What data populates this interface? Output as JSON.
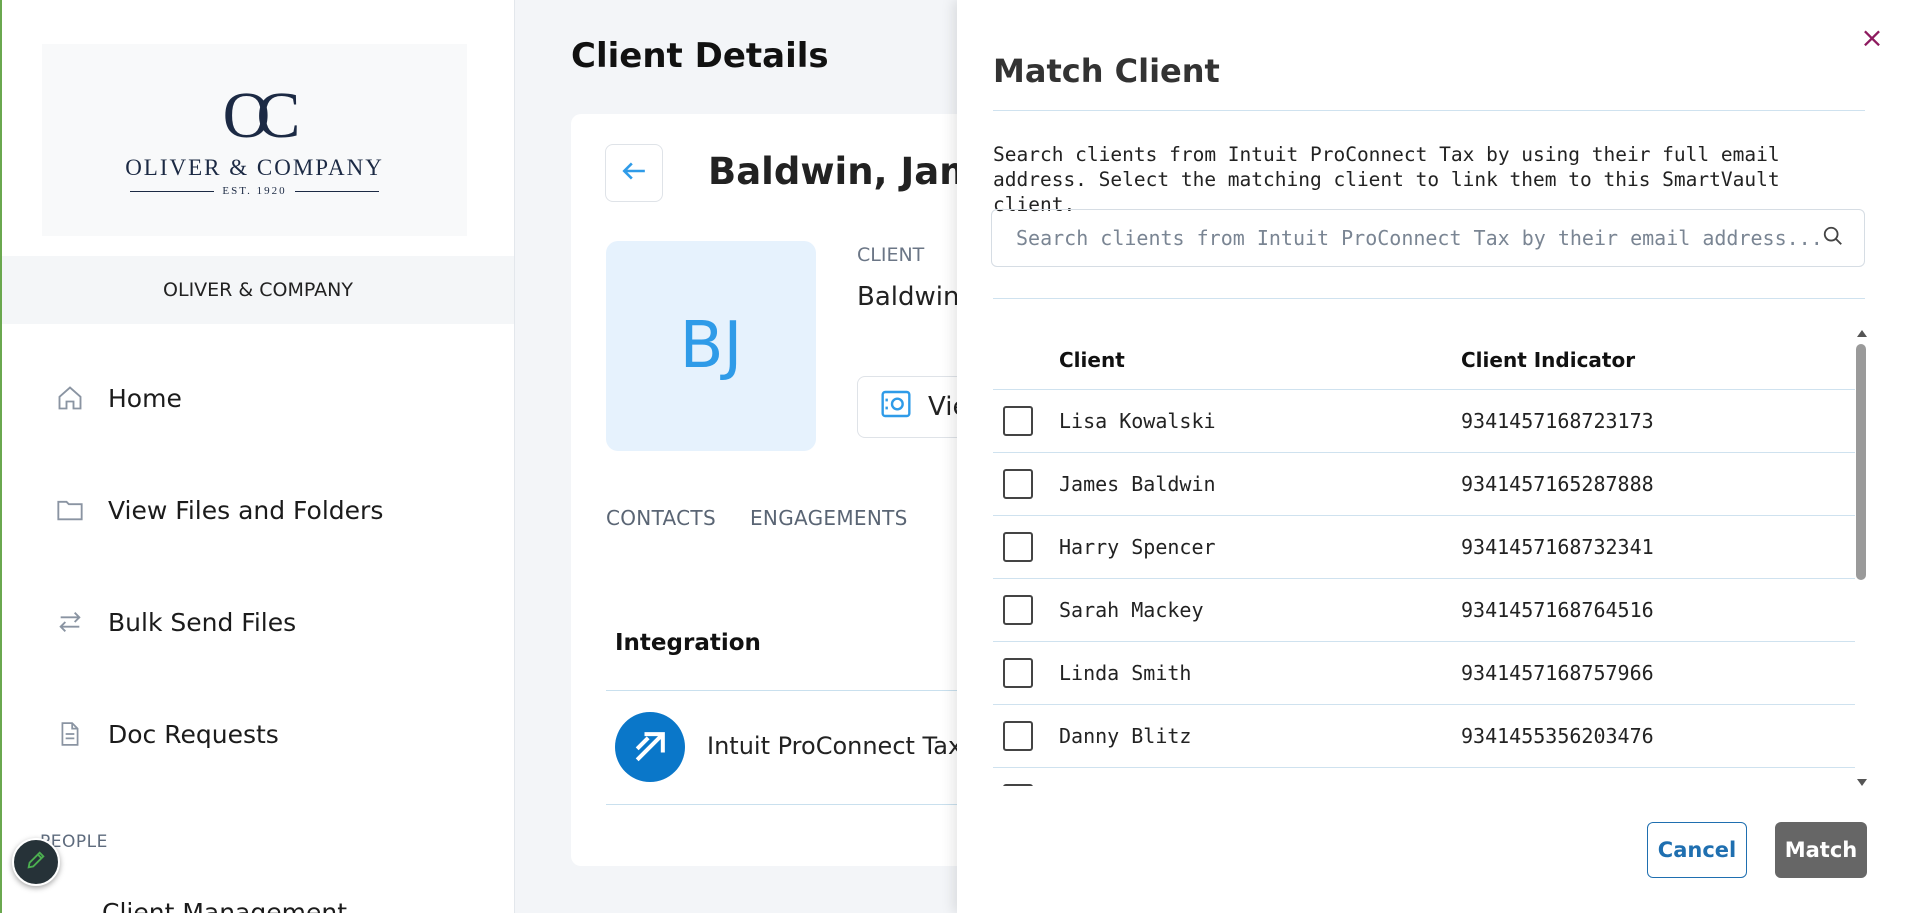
{
  "sidebar": {
    "logo": {
      "monogram": "OC",
      "name": "OLIVER & COMPANY",
      "est": "EST. 1920"
    },
    "org_name": "OLIVER & COMPANY",
    "nav": [
      {
        "label": "Home",
        "icon": "home-icon"
      },
      {
        "label": "View Files and Folders",
        "icon": "folder-icon"
      },
      {
        "label": "Bulk Send Files",
        "icon": "transfer-icon"
      },
      {
        "label": "Doc Requests",
        "icon": "document-icon"
      }
    ],
    "section_label": "PEOPLE",
    "cut_item": "Client Management"
  },
  "main": {
    "title": "Client Details",
    "client": {
      "name": "Baldwin, James",
      "initials": "BJ",
      "label": "CLIENT",
      "sub_name": "Baldwin",
      "view_button": "View"
    },
    "tabs": [
      "CONTACTS",
      "ENGAGEMENTS"
    ],
    "integration": {
      "title": "Integration",
      "name": "Intuit ProConnect Tax"
    }
  },
  "drawer": {
    "title": "Match Client",
    "close_label": "×",
    "description": "Search clients from Intuit ProConnect Tax by using their full email address. Select the matching client to link them to this SmartVault client.",
    "search_placeholder": "Search clients from Intuit ProConnect Tax by their email address...",
    "table": {
      "headers": [
        "Client",
        "Client Indicator"
      ],
      "rows": [
        {
          "client": "Lisa Kowalski",
          "indicator": "9341457168723173"
        },
        {
          "client": "James Baldwin",
          "indicator": "9341457165287888"
        },
        {
          "client": "Harry Spencer",
          "indicator": "9341457168732341"
        },
        {
          "client": "Sarah Mackey",
          "indicator": "9341457168764516"
        },
        {
          "client": "Linda Smith",
          "indicator": "9341457168757966"
        },
        {
          "client": "Danny Blitz",
          "indicator": "9341455356203476"
        }
      ]
    },
    "cancel_label": "Cancel",
    "match_label": "Match"
  },
  "colors": {
    "accent": "#2f9be8",
    "close": "#8e1b5f",
    "button_primary": "#666666",
    "link_blue": "#1f6fb0"
  }
}
